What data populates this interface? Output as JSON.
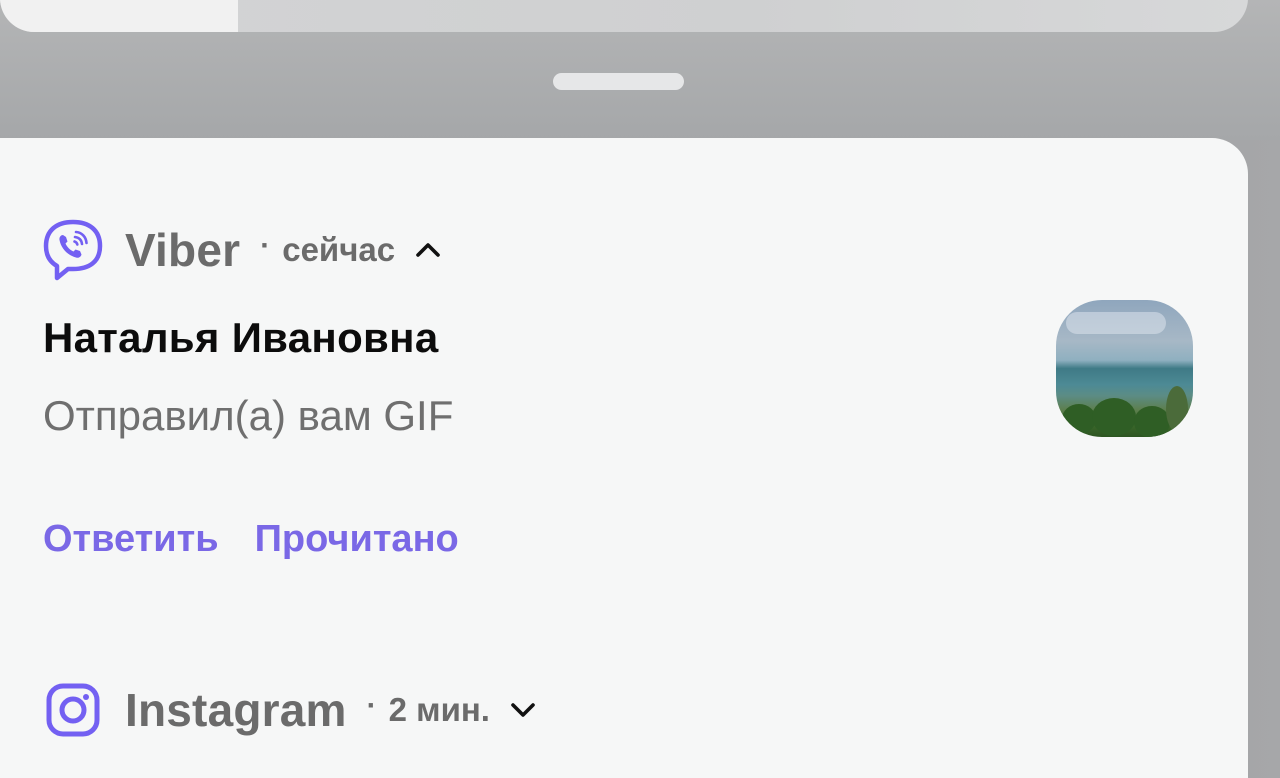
{
  "notifications": [
    {
      "app": "Viber",
      "app_icon": "viber-icon",
      "time": "сейчас",
      "expanded": true,
      "toggle_icon": "chevron-up-icon",
      "sender": "Наталья Ивановна",
      "message": "Отправил(а) вам GIF",
      "thumbnail": "gif-thumbnail",
      "actions": [
        "Ответить",
        "Прочитано"
      ],
      "accent_color": "#7360f2"
    },
    {
      "app": "Instagram",
      "app_icon": "instagram-icon",
      "time": "2 мин.",
      "expanded": false,
      "toggle_icon": "chevron-down-icon"
    }
  ],
  "separator": "·"
}
